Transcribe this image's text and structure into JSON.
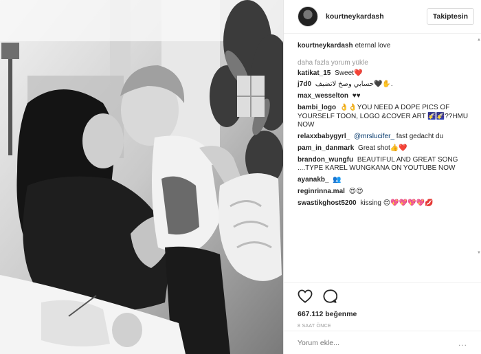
{
  "post": {
    "username": "kourtneykardash",
    "follow_label": "Takiptesin",
    "caption": "eternal love",
    "load_more": "daha fazla yorum yükle",
    "likes": "667.112 beğenme",
    "time_ago": "8 SAAT ÖNCE",
    "comment_placeholder": "Yorum ekle...",
    "more_dots": "..."
  },
  "comments": [
    {
      "user": "katikat_15",
      "text": "Sweet❤️"
    },
    {
      "user": "j7d0",
      "text": "حسابي وصخ لاتضيف🖤✋."
    },
    {
      "user": "max_wesselton",
      "text": "♥♥"
    },
    {
      "user": "bambi_logo",
      "text": "👌👌YOU NEED A DOPE PICS OF YOURSELF TOON, LOGO &COVER ART 🌠🌠??HMU NOW"
    },
    {
      "user": "relaxxbabygyrl_",
      "mention": "@mrslucifer_",
      "text": "fast gedacht du"
    },
    {
      "user": "pam_in_danmark",
      "text": "Great shot👍❤️"
    },
    {
      "user": "brandon_wungfu",
      "text": "BEAUTIFUL AND GREAT SONG ....TYPE KAREL WUNGKANA ON YOUTUBE NOW"
    },
    {
      "user": "ayanakb_",
      "text": "👥"
    },
    {
      "user": "reginrinna.mal",
      "text": "😍😍"
    },
    {
      "user": "swastikghost5200",
      "text": "kissing 😍💖💖💖💖💋"
    }
  ],
  "icons": {
    "heart": "heart-icon",
    "comment": "comment-icon",
    "avatar": "avatar",
    "scroll_up": "▲",
    "scroll_down": "▼"
  }
}
